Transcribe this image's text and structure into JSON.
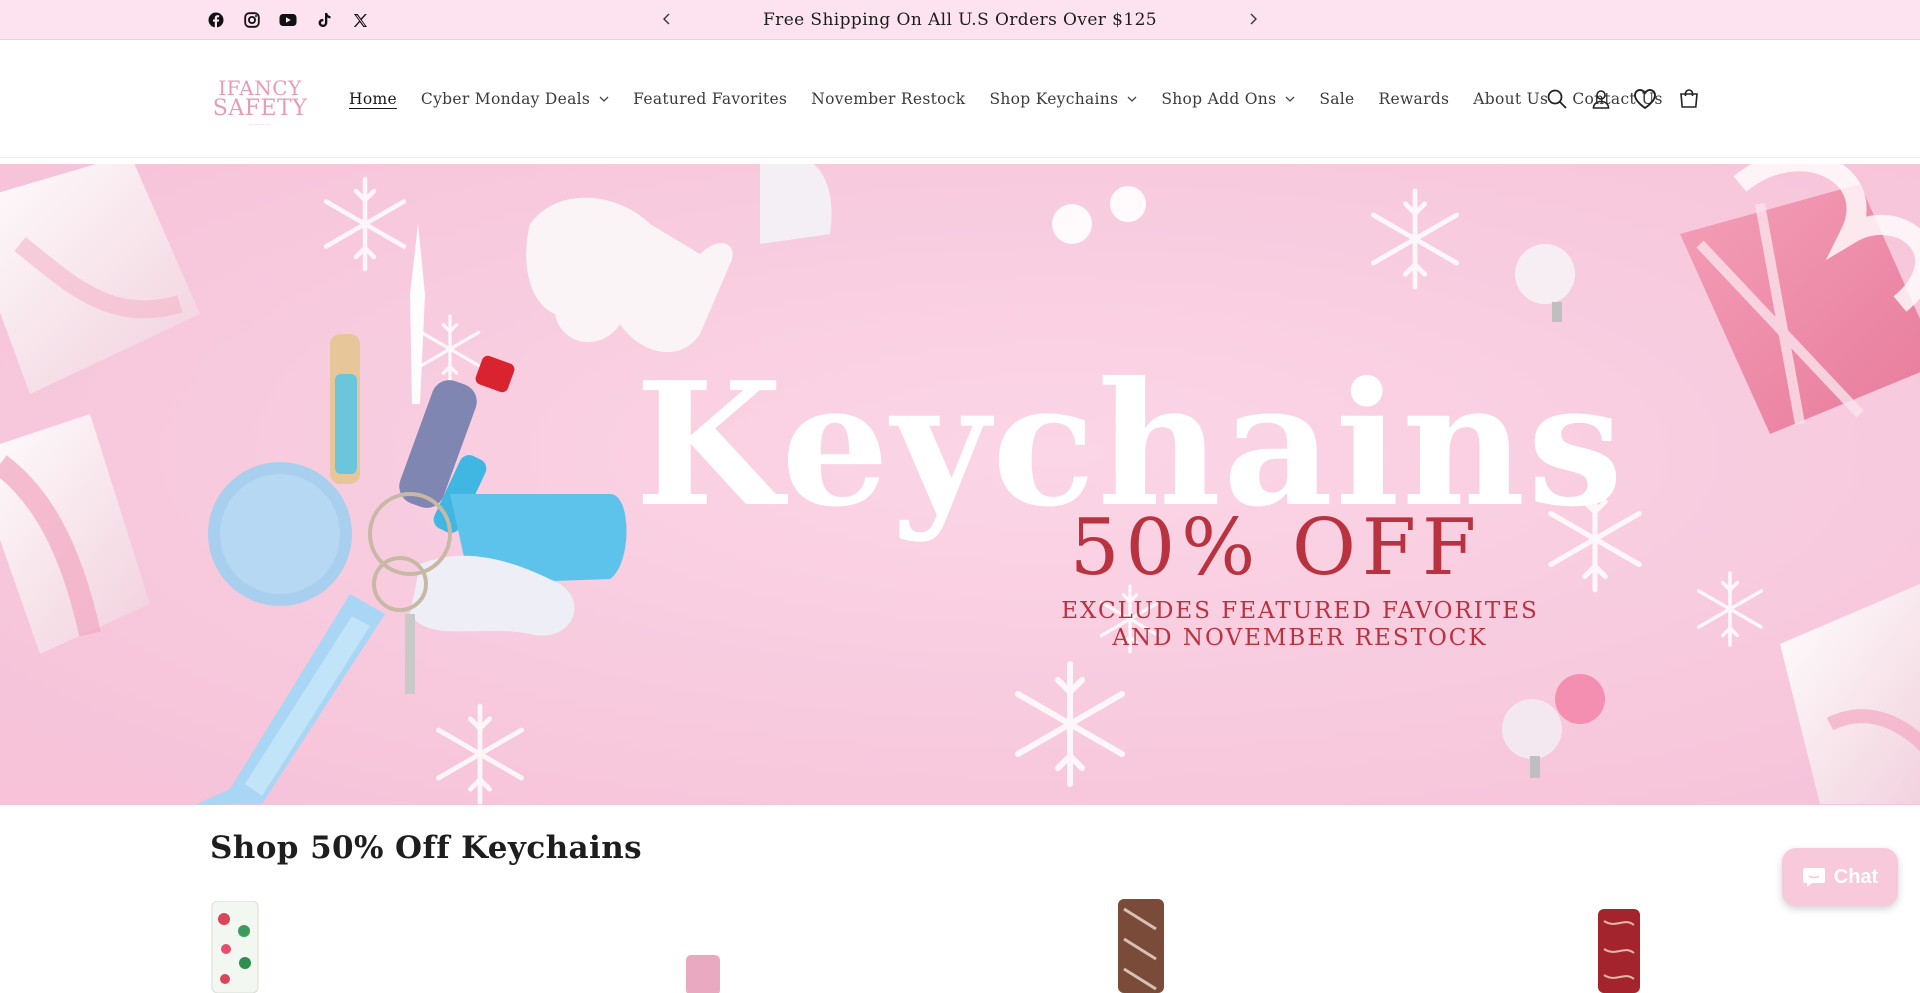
{
  "announcement": {
    "message": "Free Shipping On All U.S Orders Over $125",
    "social_icons": [
      "facebook-icon",
      "instagram-icon",
      "youtube-icon",
      "tiktok-icon",
      "x-icon"
    ]
  },
  "header": {
    "logo": {
      "line1": "IFANCY",
      "line2": "SAFETY"
    },
    "nav": [
      {
        "label": "Home",
        "active": true,
        "dropdown": false
      },
      {
        "label": "Cyber Monday Deals",
        "dropdown": true
      },
      {
        "label": "Featured Favorites",
        "dropdown": false
      },
      {
        "label": "November Restock",
        "dropdown": false
      },
      {
        "label": "Shop Keychains",
        "dropdown": true
      },
      {
        "label": "Shop Add Ons",
        "dropdown": true
      },
      {
        "label": "Sale",
        "dropdown": false
      },
      {
        "label": "Rewards",
        "dropdown": false
      },
      {
        "label": "About Us",
        "dropdown": false
      },
      {
        "label": "Contact Us",
        "dropdown": false
      }
    ],
    "icons": [
      "search-icon",
      "account-icon",
      "wishlist-icon",
      "cart-icon"
    ]
  },
  "hero": {
    "headline": "Keychains",
    "offer": "50% OFF",
    "note_line1": "EXCLUDES FEATURED FAVORITES",
    "note_line2": "AND NOVEMBER RESTOCK",
    "colors": {
      "background": "#f8cde0",
      "headline": "#ffffff",
      "offer": "#b8333f"
    }
  },
  "section": {
    "title": "Shop 50% Off Keychains"
  },
  "chat": {
    "label": "Chat"
  },
  "colors": {
    "announcement_bg": "#fde3ef",
    "logo": "#e89bb5",
    "chat_bg": "#f8c9da"
  }
}
